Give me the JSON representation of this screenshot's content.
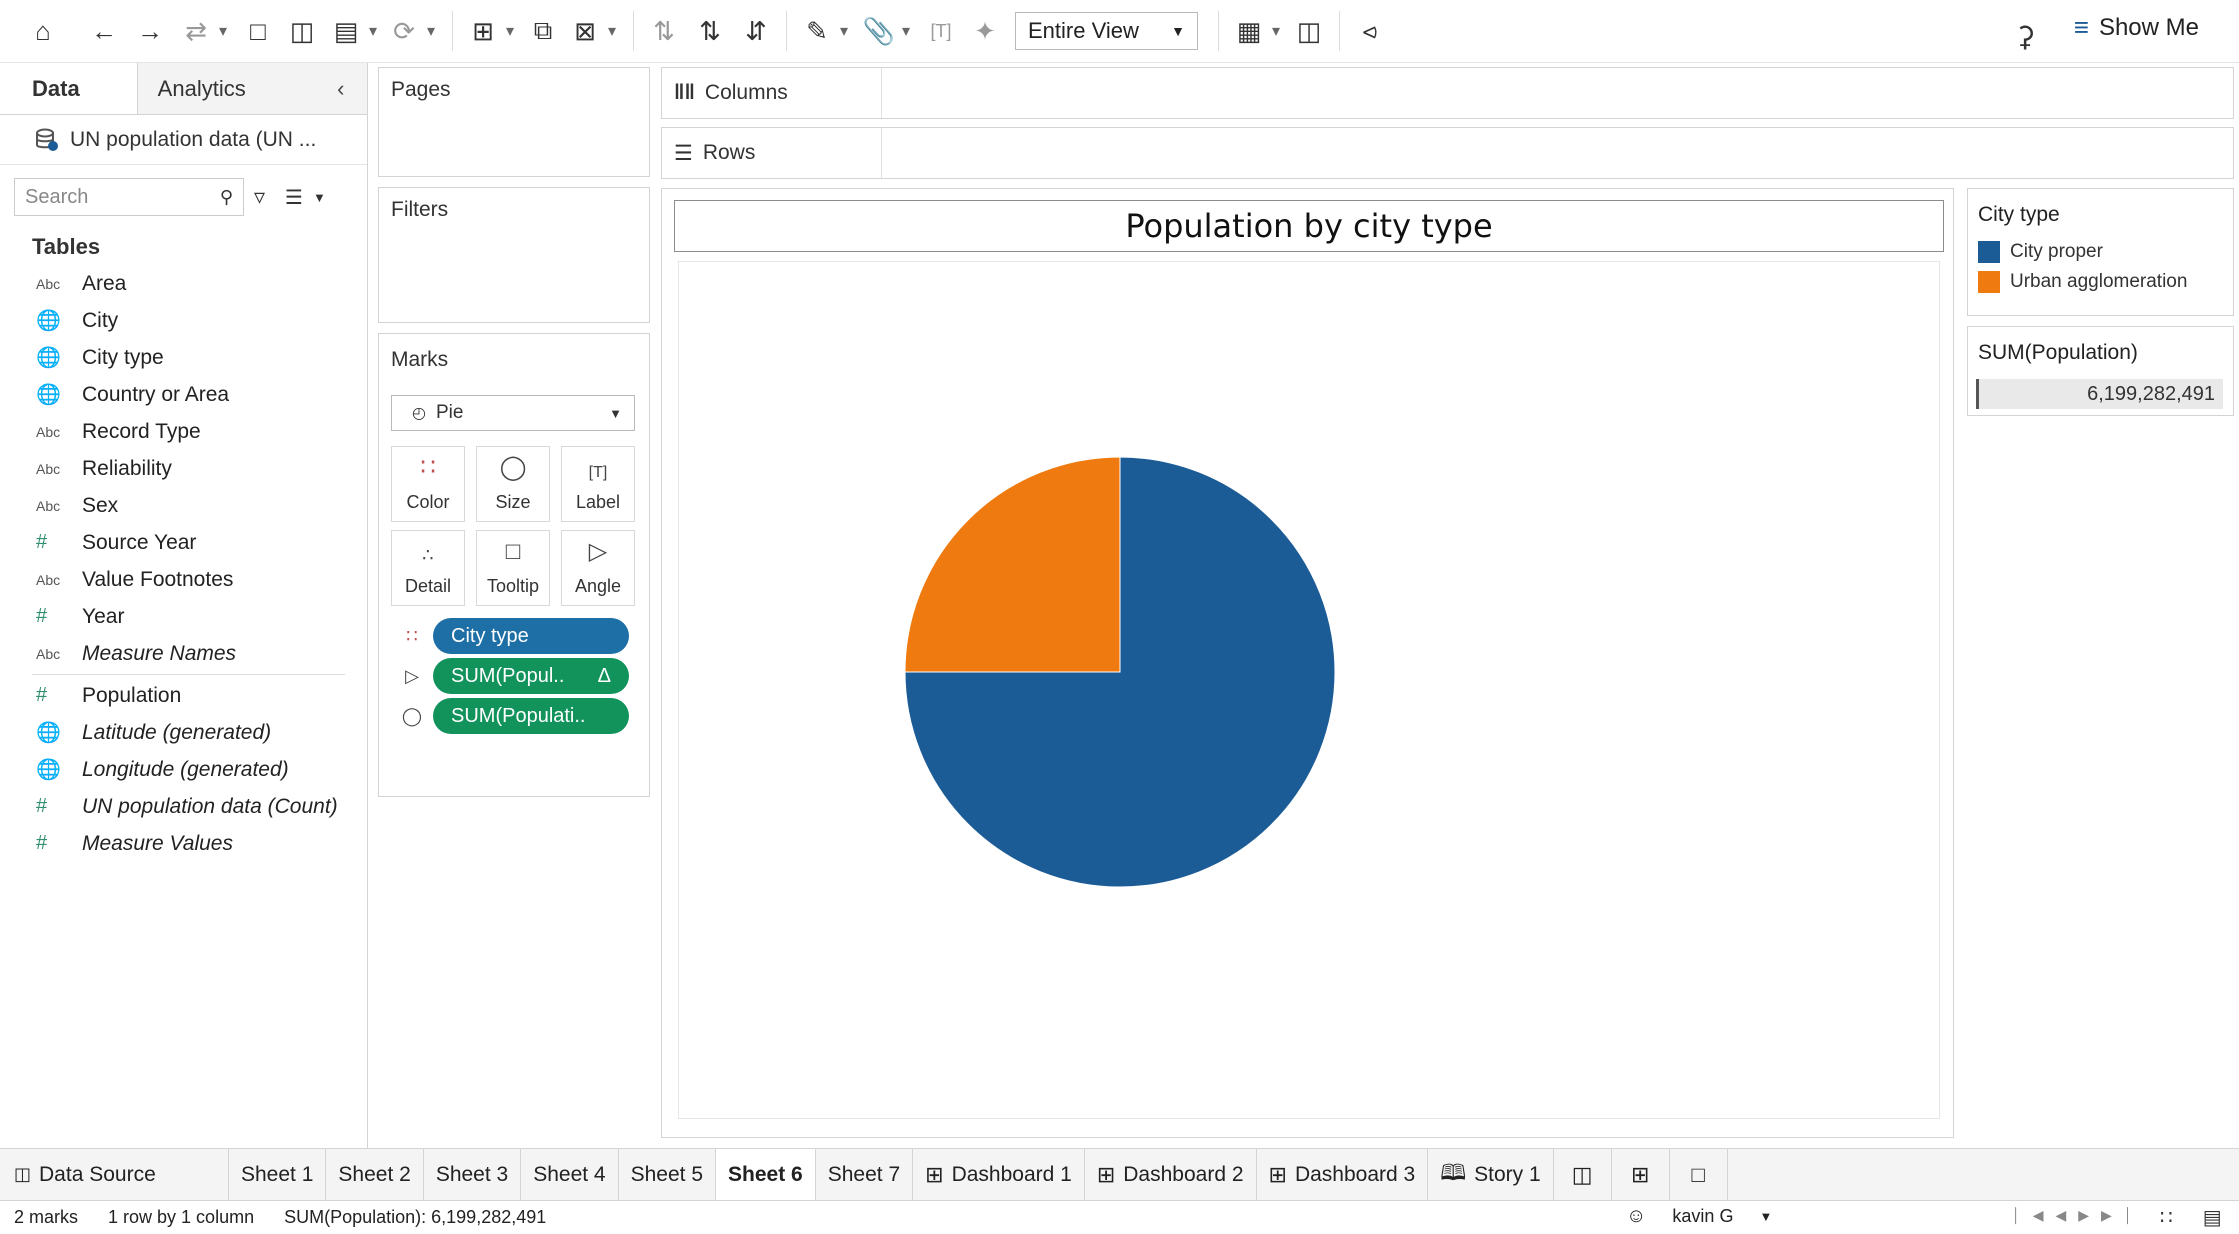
{
  "toolbar": {
    "view_mode": "Entire View",
    "show_me": "Show Me"
  },
  "data_pane": {
    "tab_data": "Data",
    "tab_analytics": "Analytics",
    "datasource": "UN population data (UN ...",
    "search_placeholder": "Search",
    "tables_header": "Tables",
    "fields": [
      {
        "name": "Area",
        "type": "Abc"
      },
      {
        "name": "City",
        "type": "geo"
      },
      {
        "name": "City type",
        "type": "geo"
      },
      {
        "name": "Country or Area",
        "type": "geo"
      },
      {
        "name": "Record Type",
        "type": "Abc"
      },
      {
        "name": "Reliability",
        "type": "Abc"
      },
      {
        "name": "Sex",
        "type": "Abc"
      },
      {
        "name": "Source Year",
        "type": "#"
      },
      {
        "name": "Value Footnotes",
        "type": "Abc"
      },
      {
        "name": "Year",
        "type": "#"
      },
      {
        "name": "Measure Names",
        "type": "Abc"
      }
    ],
    "measures": [
      {
        "name": "Population",
        "type": "#"
      },
      {
        "name": "Latitude (generated)",
        "type": "geo"
      },
      {
        "name": "Longitude (generated)",
        "type": "geo"
      },
      {
        "name": "UN population data (Count)",
        "type": "#"
      },
      {
        "name": "Measure Values",
        "type": "#"
      }
    ]
  },
  "shelves": {
    "pages": "Pages",
    "filters": "Filters",
    "marks": "Marks",
    "mark_type": "Pie",
    "mark_buttons": [
      "Color",
      "Size",
      "Label",
      "Detail",
      "Tooltip",
      "Angle"
    ],
    "pills": [
      "City type",
      "SUM(Popul..",
      "SUM(Populati.."
    ],
    "columns": "Columns",
    "rows": "Rows"
  },
  "colors": {
    "city_proper": "#1b5b96",
    "urban_agglomeration": "#ef7a0f"
  },
  "viz": {
    "title": "Population by city type"
  },
  "chart_data": {
    "type": "pie",
    "title": "Population by city type",
    "categories": [
      "City proper",
      "Urban agglomeration"
    ],
    "values": [
      75,
      25
    ],
    "value_unit": "percent of SUM(Population) (estimated)",
    "total": "6,199,282,491"
  },
  "legend": {
    "title": "City type",
    "items": [
      "City proper",
      "Urban agglomeration"
    ],
    "sum_title": "SUM(Population)",
    "sum_value": "6,199,282,491"
  },
  "sheet_tabs": {
    "data_source": "Data Source",
    "tabs": [
      "Sheet 1",
      "Sheet 2",
      "Sheet 3",
      "Sheet 4",
      "Sheet 5",
      "Sheet 6",
      "Sheet 7",
      "Dashboard 1",
      "Dashboard 2",
      "Dashboard 3",
      "Story 1"
    ],
    "active": "Sheet 6"
  },
  "status": {
    "marks": "2 marks",
    "dims": "1 row by 1 column",
    "sum": "SUM(Population): 6,199,282,491",
    "user": "kavin G"
  }
}
